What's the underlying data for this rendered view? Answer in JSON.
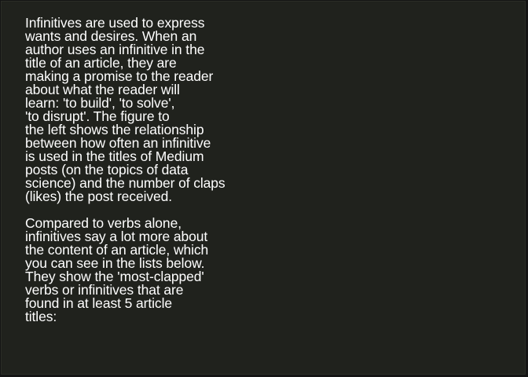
{
  "paragraphs": [
    {
      "lines": [
        "Infinitives are used to express",
        "wants and desires. When an",
        "author uses an infinitive in the",
        "title of an article, they are",
        "making a promise to the reader",
        "about what the reader will",
        "learn: 'to build', 'to solve',",
        "'to disrupt'. The figure to",
        "the left shows the relationship",
        "between how often an infinitive",
        "is used in the titles of Medium",
        "posts (on the topics of data",
        "science) and the number of claps",
        "(likes) the post received."
      ]
    },
    {
      "lines": [
        "Compared to verbs alone,",
        "infinitives say a lot more about",
        "the content of an article, which",
        "you can see in the lists below.",
        "They show the 'most-clapped'",
        "verbs or infinitives that are",
        "found in at least 5 article",
        "titles:"
      ]
    }
  ]
}
